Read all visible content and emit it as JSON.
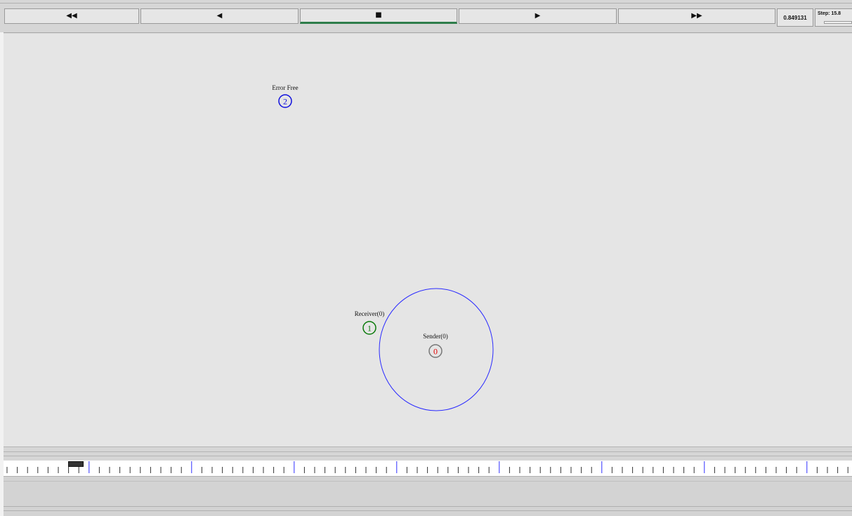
{
  "toolbar": {
    "buttons": [
      {
        "name": "rewind-button",
        "icon": "fast-rewind-icon",
        "glyph": "◀◀"
      },
      {
        "name": "step-back-button",
        "icon": "play-backward-icon",
        "glyph": "◀"
      },
      {
        "name": "stop-button",
        "icon": "stop-icon",
        "glyph": "■"
      },
      {
        "name": "play-button",
        "icon": "play-forward-icon",
        "glyph": "▶"
      },
      {
        "name": "fast-forward-button",
        "icon": "fast-forward-icon",
        "glyph": "▶▶"
      }
    ],
    "active_button": "stop-button",
    "time_value": "0.849131",
    "step_label": "Step: 15.8"
  },
  "nodes": [
    {
      "id": "0",
      "label": "Sender(0)",
      "ring_color": "#777777",
      "text_color": "#e00000"
    },
    {
      "id": "1",
      "label": "Receiver(0)",
      "ring_color": "#0a7a0a",
      "text_color": "#0a7a0a"
    },
    {
      "id": "2",
      "label": "Error Free",
      "ring_color": "#1010dd",
      "text_color": "#1010dd"
    }
  ],
  "range_circle_color": "#2a2aff",
  "accent_color": "#2e7d4a"
}
